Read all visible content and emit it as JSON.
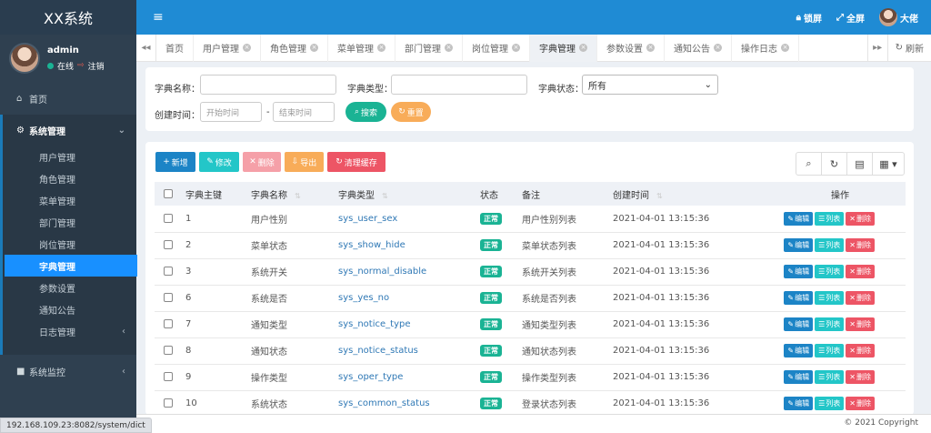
{
  "app": {
    "logo": "XX系统"
  },
  "user": {
    "name": "admin",
    "status": "在线",
    "logout": "注销",
    "top_name": "大佬"
  },
  "sidebar": {
    "home": "首页",
    "system_group": "系统管理",
    "sub_items": [
      "用户管理",
      "角色管理",
      "菜单管理",
      "部门管理",
      "岗位管理",
      "字典管理",
      "参数设置",
      "通知公告",
      "日志管理"
    ],
    "active_index": 5,
    "monitor": "系统监控"
  },
  "topbar": {
    "lock": "锁屏",
    "fullscreen": "全屏"
  },
  "tabs": {
    "items": [
      "首页",
      "用户管理",
      "角色管理",
      "菜单管理",
      "部门管理",
      "岗位管理",
      "字典管理",
      "参数设置",
      "通知公告",
      "操作日志"
    ],
    "active_index": 6,
    "refresh": "刷新"
  },
  "search": {
    "dict_name_label": "字典名称：",
    "dict_type_label": "字典类型：",
    "dict_status_label": "字典状态：",
    "status_selected": "所有",
    "create_time_label": "创建时间：",
    "start_placeholder": "开始时间",
    "end_placeholder": "结束时间",
    "dash": "-",
    "search_btn": "搜索",
    "reset_btn": "重置"
  },
  "toolbar": {
    "add": "新增",
    "edit": "修改",
    "delete": "删除",
    "export": "导出",
    "clear_cache": "清理缓存"
  },
  "table": {
    "headers": [
      "字典主键",
      "字典名称",
      "字典类型",
      "状态",
      "备注",
      "创建时间",
      "操作"
    ],
    "row_actions": {
      "edit": "编辑",
      "list": "列表",
      "delete": "删除"
    },
    "rows": [
      {
        "id": "1",
        "name": "用户性别",
        "type": "sys_user_sex",
        "status": "正常",
        "remark": "用户性别列表",
        "time": "2021-04-01 13:15:36"
      },
      {
        "id": "2",
        "name": "菜单状态",
        "type": "sys_show_hide",
        "status": "正常",
        "remark": "菜单状态列表",
        "time": "2021-04-01 13:15:36"
      },
      {
        "id": "3",
        "name": "系统开关",
        "type": "sys_normal_disable",
        "status": "正常",
        "remark": "系统开关列表",
        "time": "2021-04-01 13:15:36"
      },
      {
        "id": "6",
        "name": "系统是否",
        "type": "sys_yes_no",
        "status": "正常",
        "remark": "系统是否列表",
        "time": "2021-04-01 13:15:36"
      },
      {
        "id": "7",
        "name": "通知类型",
        "type": "sys_notice_type",
        "status": "正常",
        "remark": "通知类型列表",
        "time": "2021-04-01 13:15:36"
      },
      {
        "id": "8",
        "name": "通知状态",
        "type": "sys_notice_status",
        "status": "正常",
        "remark": "通知状态列表",
        "time": "2021-04-01 13:15:36"
      },
      {
        "id": "9",
        "name": "操作类型",
        "type": "sys_oper_type",
        "status": "正常",
        "remark": "操作类型列表",
        "time": "2021-04-01 13:15:36"
      },
      {
        "id": "10",
        "name": "系统状态",
        "type": "sys_common_status",
        "status": "正常",
        "remark": "登录状态列表",
        "time": "2021-04-01 13:15:36"
      }
    ]
  },
  "footer": {
    "copyright": "© 2021 Copyright",
    "status_url": "192.168.109.23:8082/system/dict"
  },
  "colors": {
    "topbar": "#1f8bd4",
    "sidebar": "#2f4050",
    "active": "#1890ff",
    "success": "#1ab394",
    "primary": "#1c84c6",
    "info": "#23c6c8",
    "danger": "#ed5565",
    "warning": "#f8ac59"
  }
}
